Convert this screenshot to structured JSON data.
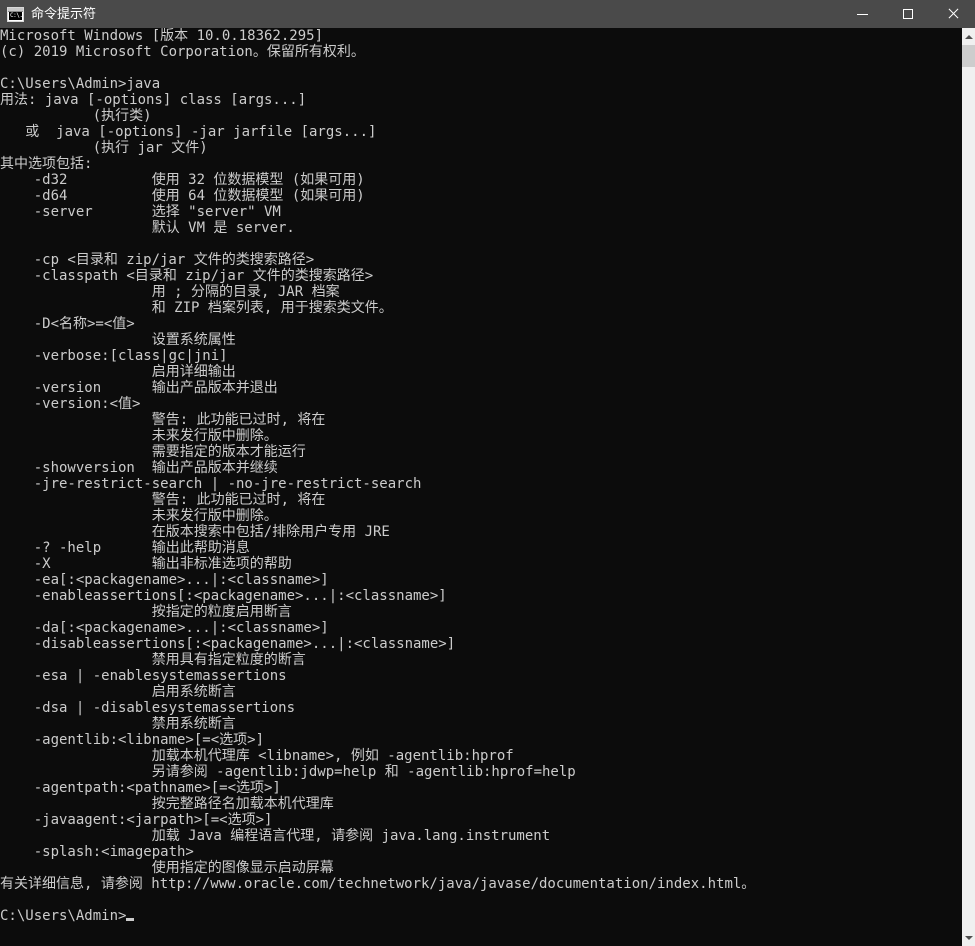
{
  "window": {
    "title": "命令提示符",
    "icon_name": "cmd-icon",
    "icon_text": "C:\\.",
    "colors": {
      "titlebar_bg": "#4a4a4a",
      "console_bg": "#0c0c0c",
      "console_fg": "#cccccc",
      "scrollbar_track": "#f0f0f0",
      "scrollbar_thumb": "#cdcdcd"
    },
    "controls": {
      "minimize_label": "最小化",
      "maximize_label": "最大化",
      "close_label": "关闭"
    }
  },
  "scrollbar": {
    "orientation": "vertical",
    "thumb_position_percent": 0,
    "up_arrow_label": "向上滚动",
    "down_arrow_label": "向下滚动"
  },
  "console": {
    "prompt": "C:\\Users\\Admin>",
    "command": "java",
    "cursor_visible": true,
    "lines": [
      "Microsoft Windows [版本 10.0.18362.295]",
      "(c) 2019 Microsoft Corporation。保留所有权利。",
      "",
      "C:\\Users\\Admin>java",
      "用法: java [-options] class [args...]",
      "           (执行类)",
      "   或  java [-options] -jar jarfile [args...]",
      "           (执行 jar 文件)",
      "其中选项包括:",
      "    -d32          使用 32 位数据模型 (如果可用)",
      "    -d64          使用 64 位数据模型 (如果可用)",
      "    -server       选择 \"server\" VM",
      "                  默认 VM 是 server.",
      "",
      "    -cp <目录和 zip/jar 文件的类搜索路径>",
      "    -classpath <目录和 zip/jar 文件的类搜索路径>",
      "                  用 ; 分隔的目录, JAR 档案",
      "                  和 ZIP 档案列表, 用于搜索类文件。",
      "    -D<名称>=<值>",
      "                  设置系统属性",
      "    -verbose:[class|gc|jni]",
      "                  启用详细输出",
      "    -version      输出产品版本并退出",
      "    -version:<值>",
      "                  警告: 此功能已过时, 将在",
      "                  未来发行版中删除。",
      "                  需要指定的版本才能运行",
      "    -showversion  输出产品版本并继续",
      "    -jre-restrict-search | -no-jre-restrict-search",
      "                  警告: 此功能已过时, 将在",
      "                  未来发行版中删除。",
      "                  在版本搜索中包括/排除用户专用 JRE",
      "    -? -help      输出此帮助消息",
      "    -X            输出非标准选项的帮助",
      "    -ea[:<packagename>...|:<classname>]",
      "    -enableassertions[:<packagename>...|:<classname>]",
      "                  按指定的粒度启用断言",
      "    -da[:<packagename>...|:<classname>]",
      "    -disableassertions[:<packagename>...|:<classname>]",
      "                  禁用具有指定粒度的断言",
      "    -esa | -enablesystemassertions",
      "                  启用系统断言",
      "    -dsa | -disablesystemassertions",
      "                  禁用系统断言",
      "    -agentlib:<libname>[=<选项>]",
      "                  加载本机代理库 <libname>, 例如 -agentlib:hprof",
      "                  另请参阅 -agentlib:jdwp=help 和 -agentlib:hprof=help",
      "    -agentpath:<pathname>[=<选项>]",
      "                  按完整路径名加载本机代理库",
      "    -javaagent:<jarpath>[=<选项>]",
      "                  加载 Java 编程语言代理, 请参阅 java.lang.instrument",
      "    -splash:<imagepath>",
      "                  使用指定的图像显示启动屏幕",
      "有关详细信息, 请参阅 http://www.oracle.com/technetwork/java/javase/documentation/index.html。",
      "",
      "C:\\Users\\Admin>"
    ]
  }
}
